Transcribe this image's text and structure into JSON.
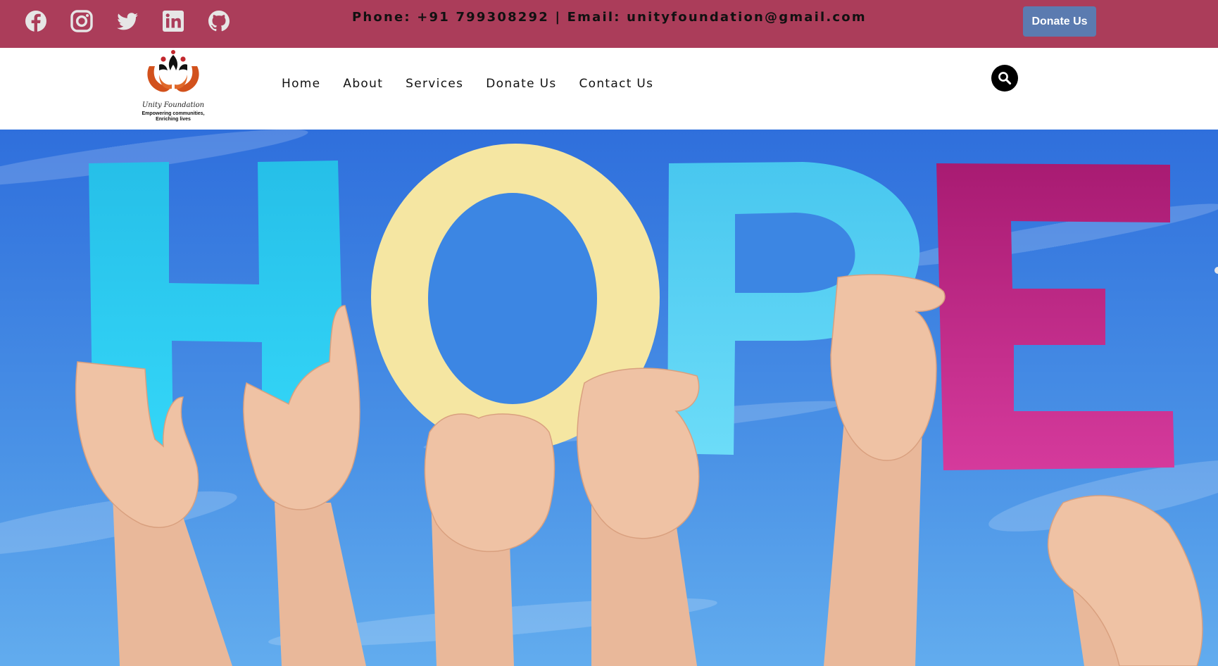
{
  "topbar": {
    "social": [
      {
        "name": "facebook",
        "icon": "facebook-icon"
      },
      {
        "name": "instagram",
        "icon": "instagram-icon"
      },
      {
        "name": "twitter",
        "icon": "twitter-icon"
      },
      {
        "name": "linkedin",
        "icon": "linkedin-icon"
      },
      {
        "name": "github",
        "icon": "github-icon"
      }
    ],
    "contact_text": "Phone: +91 799308292 | Email: unityfoundation@gmail.com",
    "donate_label": "Donate Us",
    "background_color": "#ab3d5a",
    "donate_button_color": "#5b7bb0"
  },
  "logo": {
    "title": "Unity Foundation",
    "tagline_line1": "Empowering communities,",
    "tagline_line2": "Enriching lives"
  },
  "nav": {
    "items": [
      "Home",
      "About",
      "Services",
      "Donate Us",
      "Contact Us"
    ],
    "search_icon": "search-icon"
  },
  "hero": {
    "image_subject": "hands holding up colorful letters against a blue sky",
    "letters": [
      "H",
      "O",
      "P",
      "E"
    ],
    "letter_colors": [
      "#2ec9ef",
      "#f6e7a3",
      "#4fd0f2",
      "#c72a8a"
    ],
    "sky_color": "#3f86e3"
  }
}
